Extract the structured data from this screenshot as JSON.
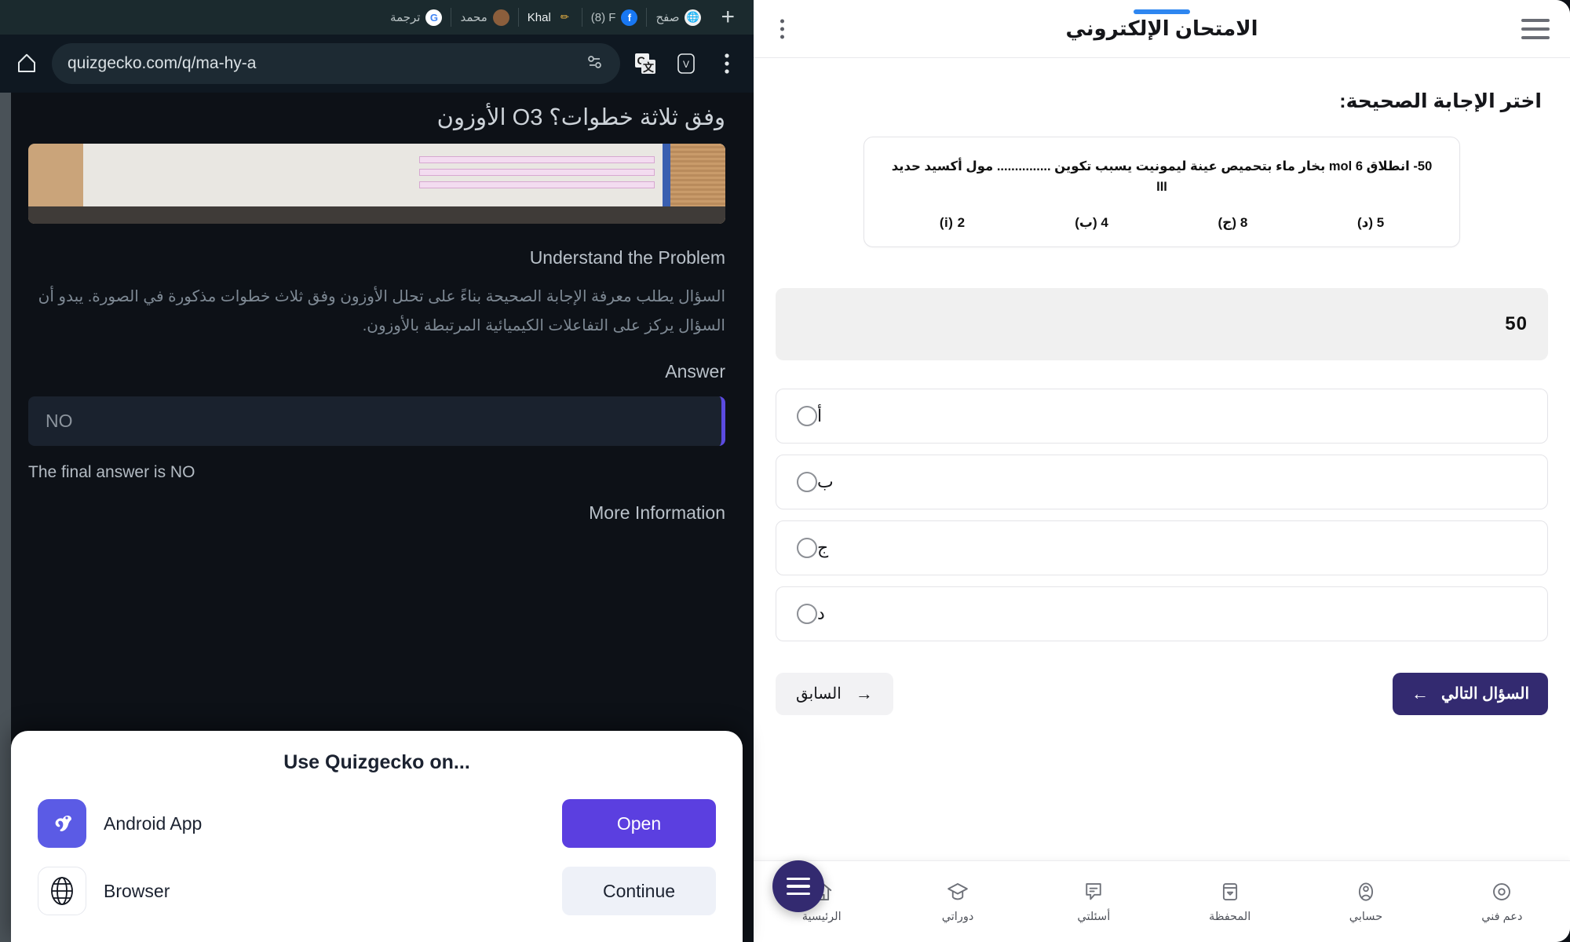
{
  "app": {
    "title": "الامتحان الإلكتروني",
    "kebab_icon": "kebab-menu-icon",
    "hamburger_icon": "hamburger-menu-icon",
    "prompt": "اختر الإجابة الصحيحة:",
    "question": {
      "text": "50- انطلاق 6 mol بخار ماء بتحميص عينة ليمونيت يسبب تكوين ............... مول أكسيد حديد III",
      "choices": [
        {
          "key": "(i)",
          "label": "2 (i)"
        },
        {
          "key": "(ب)",
          "label": "4 (ب)"
        },
        {
          "key": "(ج)",
          "label": "8 (ج)"
        },
        {
          "key": "(د)",
          "label": "5 (د)"
        }
      ]
    },
    "answer_display": "50",
    "options": [
      {
        "label": "أ",
        "selected": false
      },
      {
        "label": "ب",
        "selected": false
      },
      {
        "label": "ج",
        "selected": false
      },
      {
        "label": "د",
        "selected": false
      }
    ],
    "nav": {
      "next_label": "السؤال التالي",
      "next_arrow": "→",
      "prev_label": "السابق",
      "prev_arrow": "←"
    },
    "bottom_nav": [
      {
        "label": "الرئيسية",
        "icon": "home-icon"
      },
      {
        "label": "دوراتي",
        "icon": "graduation-cap-icon"
      },
      {
        "label": "أسئلتي",
        "icon": "chat-bubble-icon"
      },
      {
        "label": "المحفظة",
        "icon": "wallet-icon"
      },
      {
        "label": "حسابي",
        "icon": "user-account-icon"
      },
      {
        "label": "دعم فني",
        "icon": "support-icon"
      }
    ],
    "fab_icon": "menu-fab-icon",
    "accent": "#332a70",
    "title_underline_color": "#2e86f0"
  },
  "browser": {
    "new_tab_icon": "plus-icon",
    "tabs": [
      {
        "label": "ترجمة",
        "favicon": "google-icon"
      },
      {
        "label": "محمد",
        "favicon": "avatar-icon"
      },
      {
        "label": "Khal",
        "favicon": "pencil-icon"
      },
      {
        "label": "(8) F",
        "favicon": "facebook-icon"
      },
      {
        "label": "صفح",
        "favicon": "globe-icon"
      }
    ],
    "toolbar": {
      "menu_icon": "browser-menu-icon",
      "reader_icon": "reader-view-icon",
      "translate_icon": "google-translate-icon",
      "home_icon": "home-button-icon",
      "permission_icon": "site-permissions-icon"
    },
    "url": "quizgecko.com/q/ma-hy-a",
    "page": {
      "title": "وفق ثلاثة خطوات؟ O3 الأوزون",
      "thumbnail_alt": "صورة ورقة الأسئلة",
      "section_understand": "Understand the Problem",
      "paragraph_ar": "السؤال يطلب معرفة الإجابة الصحيحة بناءً على تحلل الأوزون وفق ثلاث خطوات مذكورة في الصورة. يبدو أن السؤال يركز على التفاعلات الكيميائية المرتبطة بالأوزون.",
      "section_answer": "Answer",
      "answer_value": "NO",
      "final_answer_line": "The final answer is NO",
      "section_more": "More Information",
      "accent": "#5b4be0"
    },
    "sheet": {
      "title": "Use Quizgecko on...",
      "rows": [
        {
          "name": "Android App",
          "icon": "quizgecko-app-icon",
          "button": "Open",
          "style": "primary"
        },
        {
          "name": "Browser",
          "icon": "globe-icon",
          "button": "Continue",
          "style": "ghost"
        }
      ]
    }
  }
}
